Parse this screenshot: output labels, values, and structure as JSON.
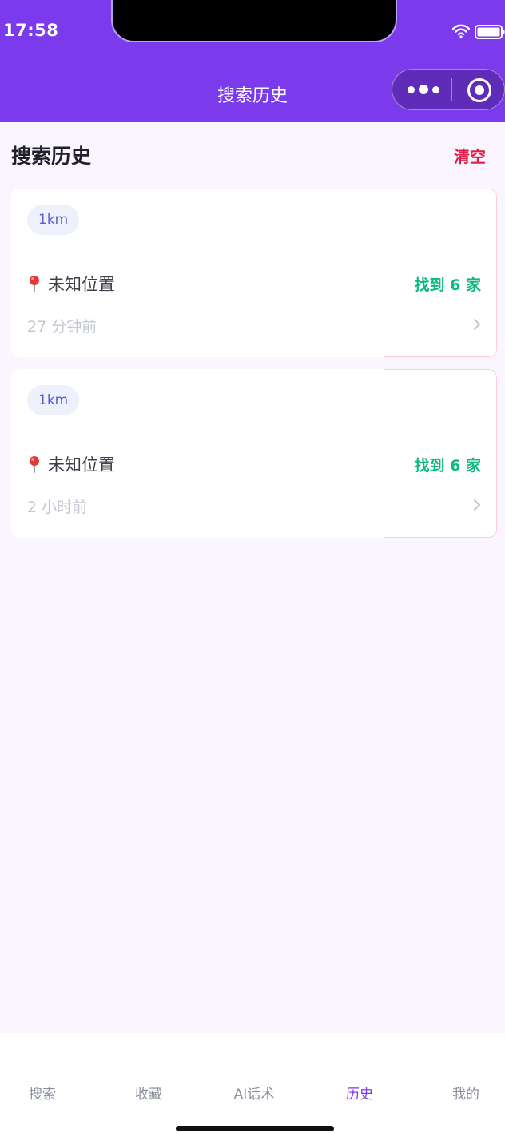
{
  "status_bar": {
    "time": "17:58"
  },
  "nav": {
    "title": "搜索历史"
  },
  "section": {
    "title": "搜索历史",
    "clear_label": "清空"
  },
  "history": [
    {
      "radius": "1km",
      "location": "未知位置",
      "found": "找到 6 家",
      "time": "27 分钟前"
    },
    {
      "radius": "1km",
      "location": "未知位置",
      "found": "找到 6 家",
      "time": "2 小时前"
    }
  ],
  "tabs": [
    {
      "label": "搜索",
      "active": false
    },
    {
      "label": "收藏",
      "active": false
    },
    {
      "label": "AI话术",
      "active": false
    },
    {
      "label": "历史",
      "active": true
    },
    {
      "label": "我的",
      "active": false
    }
  ],
  "colors": {
    "brand": "#7c3aed",
    "page_background": "#faf5ff",
    "clear": "#e11d48",
    "found": "#10b981",
    "tag_text": "#5b5fd6",
    "tab_inactive": "#8a8f9c"
  },
  "icons": [
    "wifi-icon",
    "battery-icon",
    "more-icon",
    "close-miniprogram-icon",
    "location-pin-icon",
    "chevron-right-icon"
  ]
}
